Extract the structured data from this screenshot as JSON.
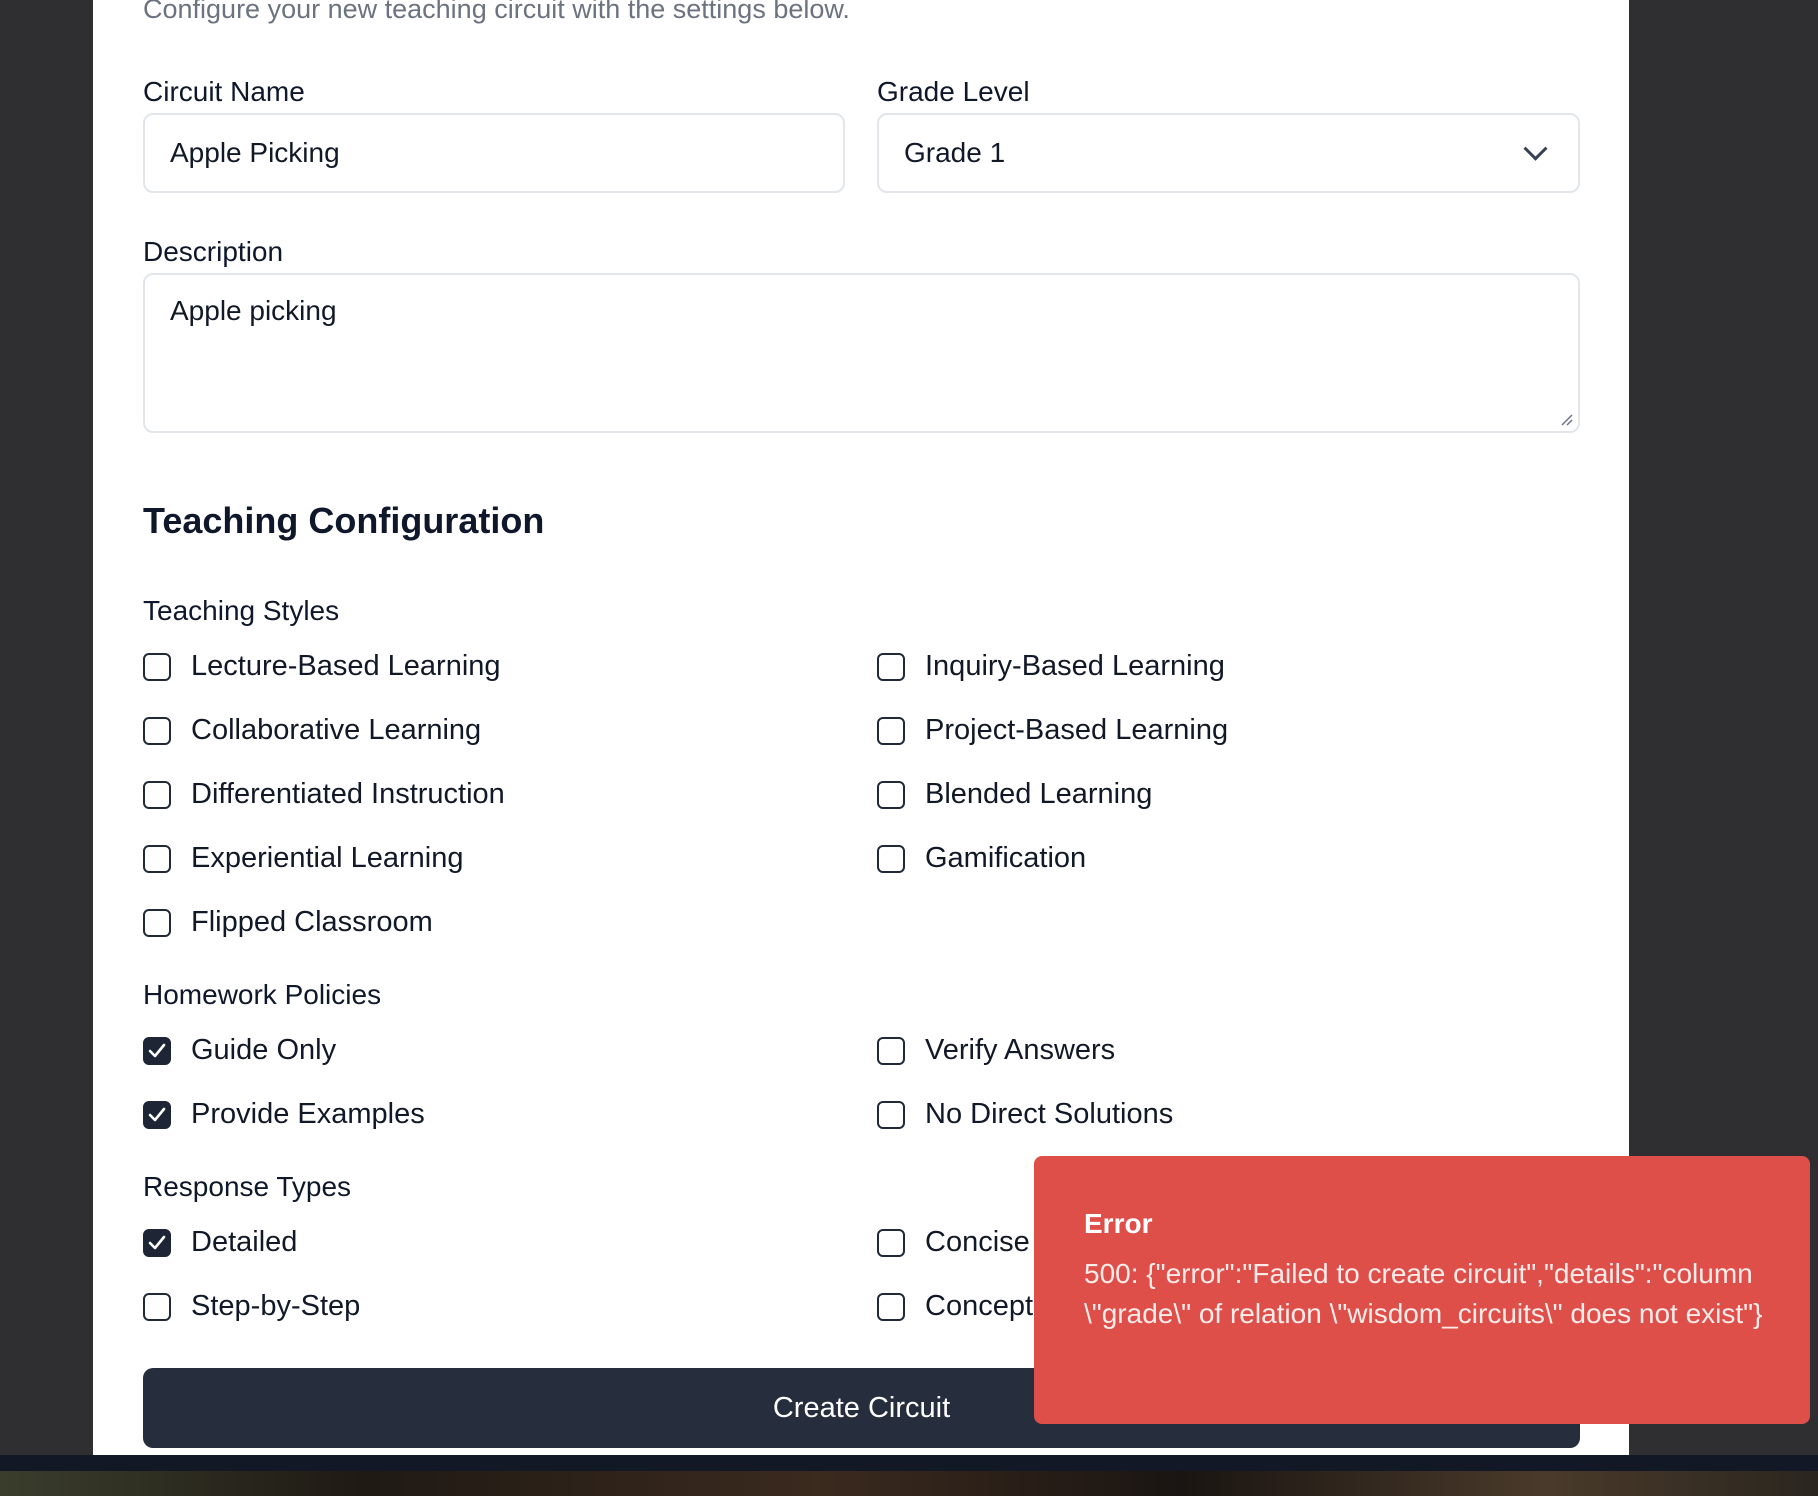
{
  "header": {
    "subtitle": "Configure your new teaching circuit with the settings below."
  },
  "form": {
    "circuit_name": {
      "label": "Circuit Name",
      "value": "Apple Picking"
    },
    "grade_level": {
      "label": "Grade Level",
      "value": "Grade 1"
    },
    "description": {
      "label": "Description",
      "value": "Apple picking"
    }
  },
  "teaching_config": {
    "title": "Teaching Configuration",
    "teaching_styles": {
      "label": "Teaching Styles",
      "options": [
        {
          "label": "Lecture-Based Learning",
          "checked": false
        },
        {
          "label": "Inquiry-Based Learning",
          "checked": false
        },
        {
          "label": "Collaborative Learning",
          "checked": false
        },
        {
          "label": "Project-Based Learning",
          "checked": false
        },
        {
          "label": "Differentiated Instruction",
          "checked": false
        },
        {
          "label": "Blended Learning",
          "checked": false
        },
        {
          "label": "Experiential Learning",
          "checked": false
        },
        {
          "label": "Gamification",
          "checked": false
        },
        {
          "label": "Flipped Classroom",
          "checked": false
        }
      ]
    },
    "homework_policies": {
      "label": "Homework Policies",
      "options": [
        {
          "label": "Guide Only",
          "checked": true
        },
        {
          "label": "Verify Answers",
          "checked": false
        },
        {
          "label": "Provide Examples",
          "checked": true
        },
        {
          "label": "No Direct Solutions",
          "checked": false
        }
      ]
    },
    "response_types": {
      "label": "Response Types",
      "options": [
        {
          "label": "Detailed",
          "checked": true
        },
        {
          "label": "Concise",
          "checked": false
        },
        {
          "label": "Step-by-Step",
          "checked": false
        },
        {
          "label": "Concept",
          "checked": false
        }
      ]
    }
  },
  "submit_label": "Create Circuit",
  "toast": {
    "title": "Error",
    "message": "500: {\"error\":\"Failed to create circuit\",\"details\":\"column \\\"grade\\\" of relation \\\"wisdom_circuits\\\" does not exist\"}"
  },
  "colors": {
    "primary": "#262d3d",
    "error": "#df4f4a",
    "backdrop": "#2f2f31"
  }
}
